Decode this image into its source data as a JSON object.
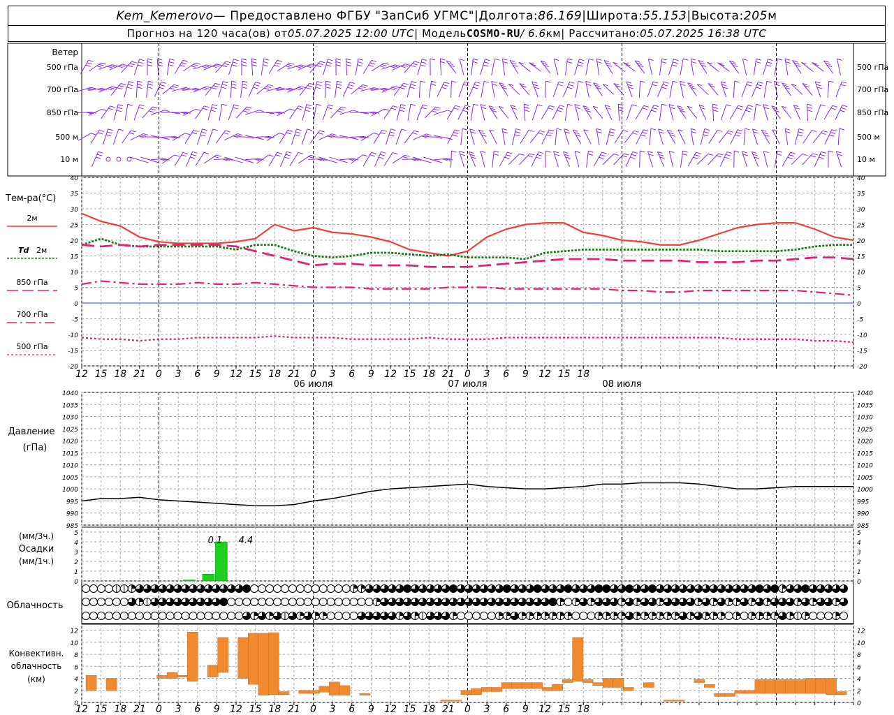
{
  "header": {
    "station": "Kem_Kemerovo",
    "provider": " — Предоставлено ФГБУ \"ЗапСиб УГМС\"",
    "sep": " | ",
    "lon_label": "Долгота: ",
    "lon_value": "86.169",
    "lat_label": "Широта: ",
    "lat_value": "55.153",
    "alt_label": "Высота: ",
    "alt_value": "205",
    "alt_unit": "м",
    "forecast_label": "Прогноз на 120 часа(ов) от ",
    "forecast_from": "05.07.2025 12:00 UTC",
    "model_label": " | Модель ",
    "model_name": "COSMO-RU",
    "model_res": " / 6.6",
    "model_res_unit": "км",
    "calc_label": " | Рассчитано: ",
    "calc_time": "05.07.2025 16:38 UTC"
  },
  "wind": {
    "title": "Ветер",
    "levels": [
      "500 гПа",
      "700 гПа",
      "850 гПа",
      "500 м",
      "10 м"
    ],
    "color": "#8a2be2"
  },
  "temp": {
    "title": "Тем-ра(°C)",
    "legend": [
      {
        "label": "2м",
        "color": "#f0403a",
        "style": "solid"
      },
      {
        "label": "Td",
        "label2": "2м",
        "color": "#1a7a1a",
        "style": "dotted"
      },
      {
        "label": "850 гПа",
        "color": "#e0207a",
        "style": "dash"
      },
      {
        "label": "700 гПа",
        "color": "#e0207a",
        "style": "dashdot"
      },
      {
        "label": "500 гПа",
        "color": "#e0207a",
        "style": "dot"
      }
    ],
    "ticks": [
      "40",
      "35",
      "30",
      "25",
      "20",
      "15",
      "10",
      "5",
      "0",
      "-5",
      "-10",
      "-15",
      "-20"
    ]
  },
  "time_axis": {
    "labels": [
      "12",
      "15",
      "18",
      "21",
      "0",
      "3",
      "6",
      "9",
      "12",
      "15",
      "18",
      "21",
      "0",
      "3",
      "6",
      "9",
      "12",
      "15",
      "18",
      "21",
      "0",
      "3",
      "6",
      "9",
      "12",
      "15",
      "18"
    ],
    "dates": [
      "06 июля",
      "07 июля",
      "08 июля"
    ]
  },
  "pressure": {
    "title": "Давление",
    "unit": "(гПа)",
    "ticks": [
      "1040",
      "1035",
      "1030",
      "1025",
      "1020",
      "1015",
      "1010",
      "1005",
      "1000",
      "995",
      "990",
      "985"
    ]
  },
  "precip": {
    "unit3": "(мм/3ч.)",
    "title": "Осадки",
    "unit1": "(мм/1ч.)",
    "ticks": [
      "5",
      "4",
      "3",
      "2",
      "1",
      "0"
    ],
    "annotations": [
      "0.1",
      "4.4"
    ],
    "color": "#1ed01e"
  },
  "cloud": {
    "title": "Облачность"
  },
  "conv": {
    "title1": "Конвективн.",
    "title2": "облачность",
    "unit": "(км)",
    "ticks": [
      "12",
      "10",
      "8",
      "6",
      "4",
      "2",
      "0"
    ],
    "color": "#f08a30"
  },
  "chart_data": [
    {
      "type": "line",
      "title": "Тем-ра(°C)",
      "ylim": [
        -20,
        40
      ],
      "x_hours_from_start": [
        0,
        3,
        6,
        9,
        12,
        15,
        18,
        21,
        24,
        27,
        30,
        33,
        36,
        39,
        42,
        45,
        48,
        51,
        54,
        57,
        60,
        63,
        66,
        69,
        72,
        75,
        78,
        81,
        84,
        87,
        90,
        93,
        96,
        99,
        102,
        105,
        108,
        111,
        114,
        117,
        120
      ],
      "series": [
        {
          "name": "2м",
          "values": [
            28.5,
            26,
            24.5,
            21,
            19.5,
            19,
            19,
            19,
            19.5,
            20.5,
            25,
            23,
            24,
            22.5,
            22,
            21,
            19.5,
            17,
            16,
            15,
            16.5,
            21,
            23.5,
            25,
            25.5,
            25.5,
            22.5,
            21.5,
            20,
            19.5,
            18.5,
            18.5,
            20,
            22,
            24,
            25,
            25.5,
            25.5,
            23.5,
            21,
            20
          ]
        },
        {
          "name": "Td 2м",
          "values": [
            18.5,
            20.5,
            18.5,
            18,
            18,
            18,
            18,
            18,
            17,
            18.5,
            18.5,
            16.5,
            15,
            14.5,
            15,
            16,
            16,
            15.5,
            15,
            15.5,
            14.5,
            14.5,
            14.5,
            14,
            16,
            16.5,
            17,
            17,
            17,
            17,
            17,
            17,
            17,
            16.5,
            16.5,
            16.5,
            16.5,
            17,
            18,
            18.5,
            18.5
          ]
        },
        {
          "name": "850 гПа",
          "values": [
            18.5,
            18,
            18.5,
            18,
            18.5,
            18.5,
            18.5,
            18.5,
            18,
            16.5,
            15,
            13.5,
            12,
            12.5,
            12.5,
            12,
            12,
            12,
            11.5,
            11.5,
            11.5,
            12,
            12.5,
            13,
            13.5,
            14,
            14,
            14,
            13.5,
            13.5,
            13.5,
            13.5,
            13,
            13,
            13,
            13.5,
            13.5,
            14,
            14.5,
            14.5,
            14
          ]
        },
        {
          "name": "700 гПа",
          "values": [
            6,
            7,
            6.5,
            6,
            6,
            6,
            6.5,
            6,
            6,
            6.5,
            6,
            5.5,
            5,
            5,
            5,
            4.5,
            4.5,
            4.5,
            4.5,
            5,
            5,
            5,
            4.5,
            4.5,
            4.5,
            4.5,
            4.5,
            4.5,
            4,
            4,
            3.5,
            3.5,
            4,
            4,
            4,
            4,
            4,
            4,
            3.5,
            3,
            2.5
          ]
        },
        {
          "name": "500 гПа",
          "values": [
            -11,
            -11.5,
            -11.5,
            -12,
            -11.5,
            -11.5,
            -11,
            -11,
            -11,
            -11,
            -10.5,
            -11,
            -11,
            -11,
            -11.5,
            -11.5,
            -11.5,
            -11.5,
            -11,
            -11.5,
            -11.5,
            -11.5,
            -11,
            -11,
            -11,
            -11,
            -11,
            -11,
            -11,
            -11,
            -11,
            -11,
            -11,
            -11,
            -11.5,
            -11.5,
            -11.5,
            -11.5,
            -12,
            -12,
            -12.5
          ]
        }
      ]
    },
    {
      "type": "line",
      "title": "Давление",
      "ylim": [
        985,
        1040
      ],
      "x_hours_from_start": [
        0,
        3,
        6,
        9,
        12,
        15,
        18,
        21,
        24,
        27,
        30,
        33,
        36,
        39,
        42,
        45,
        48,
        51,
        54,
        57,
        60,
        63,
        66,
        69,
        72,
        75,
        78,
        81,
        84,
        87,
        90,
        93,
        96,
        99,
        102,
        105,
        108,
        111,
        114,
        117,
        120
      ],
      "series": [
        {
          "name": "Давление",
          "values": [
            995,
            996,
            996,
            996.5,
            995.5,
            995,
            994.5,
            994,
            993.5,
            993,
            993,
            993.5,
            995,
            996,
            997.5,
            999,
            1000,
            1000.5,
            1001,
            1001.5,
            1002,
            1001,
            1000.5,
            1000,
            1000,
            1000.5,
            1001,
            1002,
            1002,
            1002.5,
            1002.5,
            1002.5,
            1002,
            1001,
            1000,
            1000,
            1000.5,
            1001,
            1001,
            1001,
            1001
          ]
        }
      ]
    },
    {
      "type": "bar",
      "title": "Осадки",
      "ylim": [
        0,
        5
      ],
      "x_hours_from_start": [
        16,
        19,
        21
      ],
      "values": [
        0.1,
        0.7,
        4.0
      ]
    },
    {
      "type": "bar",
      "title": "Конвективн. облачность (км)",
      "ylim": [
        0,
        12
      ],
      "bars": [
        {
          "x": 0,
          "bottom": 2.0,
          "top": 4.5
        },
        {
          "x": 2,
          "bottom": 2.0,
          "top": 4.0
        },
        {
          "x": 7,
          "bottom": 4.0,
          "top": 4.5
        },
        {
          "x": 8,
          "bottom": 4.0,
          "top": 5.0
        },
        {
          "x": 9,
          "bottom": 4.2,
          "top": 4.5
        },
        {
          "x": 10,
          "bottom": 3.5,
          "top": 11.7
        },
        {
          "x": 12,
          "bottom": 4.2,
          "top": 6.2
        },
        {
          "x": 13,
          "bottom": 5.0,
          "top": 10.8
        },
        {
          "x": 15,
          "bottom": 4.0,
          "top": 10.8
        },
        {
          "x": 16,
          "bottom": 3.0,
          "top": 11.5
        },
        {
          "x": 17,
          "bottom": 1.2,
          "top": 11.5
        },
        {
          "x": 18,
          "bottom": 1.3,
          "top": 11.6
        },
        {
          "x": 19,
          "bottom": 1.3,
          "top": 1.8
        },
        {
          "x": 21,
          "bottom": 1.5,
          "top": 2.0
        },
        {
          "x": 22,
          "bottom": 1.5,
          "top": 2.0
        },
        {
          "x": 23,
          "bottom": 1.7,
          "top": 2.7
        },
        {
          "x": 24,
          "bottom": 1.2,
          "top": 3.4
        },
        {
          "x": 25,
          "bottom": 1.2,
          "top": 2.8
        },
        {
          "x": 27,
          "bottom": 1.2,
          "top": 1.5
        },
        {
          "x": 35,
          "bottom": 0.2,
          "top": 0.4
        },
        {
          "x": 36,
          "bottom": 0.2,
          "top": 0.4
        },
        {
          "x": 37,
          "bottom": 1.3,
          "top": 2.0
        },
        {
          "x": 38,
          "bottom": 1.3,
          "top": 2.3
        },
        {
          "x": 39,
          "bottom": 1.8,
          "top": 2.5
        },
        {
          "x": 40,
          "bottom": 1.8,
          "top": 2.5
        },
        {
          "x": 41,
          "bottom": 2.3,
          "top": 3.3
        },
        {
          "x": 42,
          "bottom": 2.3,
          "top": 3.3
        },
        {
          "x": 43,
          "bottom": 2.3,
          "top": 3.3
        },
        {
          "x": 44,
          "bottom": 2.3,
          "top": 3.3
        },
        {
          "x": 45,
          "bottom": 2.0,
          "top": 2.5
        },
        {
          "x": 46,
          "bottom": 2.0,
          "top": 3.0
        },
        {
          "x": 47,
          "bottom": 3.3,
          "top": 3.8
        },
        {
          "x": 48,
          "bottom": 3.5,
          "top": 10.8
        },
        {
          "x": 49,
          "bottom": 3.3,
          "top": 3.8
        },
        {
          "x": 50,
          "bottom": 2.8,
          "top": 3.3
        },
        {
          "x": 51,
          "bottom": 2.5,
          "top": 4.0
        },
        {
          "x": 52,
          "bottom": 2.5,
          "top": 4.0
        },
        {
          "x": 53,
          "bottom": 2.0,
          "top": 2.5
        },
        {
          "x": 55,
          "bottom": 2.5,
          "top": 3.3
        },
        {
          "x": 57,
          "bottom": 0.2,
          "top": 0.4
        },
        {
          "x": 58,
          "bottom": 0.2,
          "top": 0.4
        },
        {
          "x": 60,
          "bottom": 3.3,
          "top": 3.8
        },
        {
          "x": 61,
          "bottom": 2.5,
          "top": 3.0
        },
        {
          "x": 62,
          "bottom": 1.0,
          "top": 1.5
        },
        {
          "x": 63,
          "bottom": 1.0,
          "top": 1.5
        },
        {
          "x": 64,
          "bottom": 1.5,
          "top": 2.0
        },
        {
          "x": 65,
          "bottom": 1.5,
          "top": 2.0
        },
        {
          "x": 66,
          "bottom": 1.5,
          "top": 3.8
        },
        {
          "x": 67,
          "bottom": 1.5,
          "top": 3.8
        },
        {
          "x": 68,
          "bottom": 1.5,
          "top": 3.8
        },
        {
          "x": 69,
          "bottom": 1.5,
          "top": 3.8
        },
        {
          "x": 70,
          "bottom": 1.5,
          "top": 3.8
        },
        {
          "x": 71,
          "bottom": 1.5,
          "top": 4.0
        },
        {
          "x": 72,
          "bottom": 1.5,
          "top": 4.0
        },
        {
          "x": 73,
          "bottom": 1.3,
          "top": 4.0
        },
        {
          "x": 74,
          "bottom": 1.3,
          "top": 1.8
        }
      ]
    }
  ]
}
